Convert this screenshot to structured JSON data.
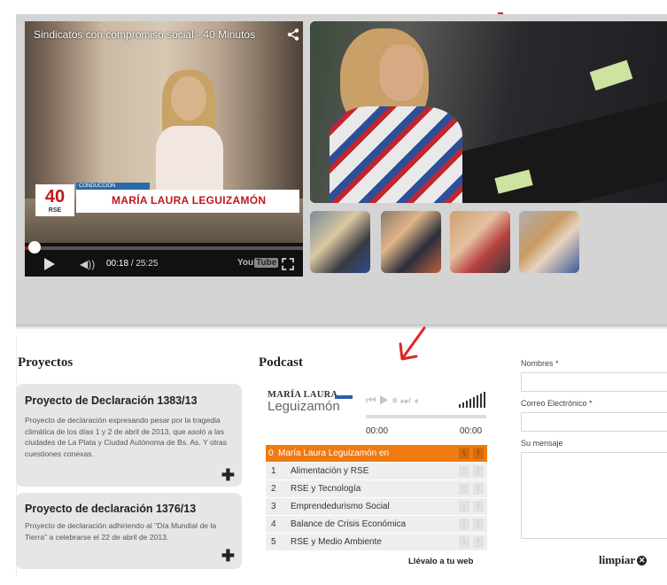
{
  "video": {
    "title": "Sindicatos con compromiso social - 40 Minutos",
    "lower_third_logo": "40",
    "lower_third_logo_sub": "RSE",
    "lower_third_caption": "CONDUCCIÓN",
    "lower_third_name": "MARÍA LAURA LEGUIZAMÓN",
    "time_current": "00:18",
    "time_total": "/ 25:25",
    "youtube_label": "You",
    "youtube_label_box": "Tube",
    "progress": 0.012
  },
  "proyectos": {
    "heading": "Proyectos",
    "items": [
      {
        "title": "Proyecto de Declaración 1383/13",
        "text": "Proyecto de declaración expresando pesar por la tragedia climática de los días 1 y 2 de abril de 2013, que asoló a las ciudades de La Plata y Ciudad Autónoma de Bs. As. Y otras cuestiones conexas."
      },
      {
        "title": "Proyecto de declaración 1376/13",
        "text": "Proyecto de declaración adhiriendo al \"Día Mundial de la Tierra\" a celebrarse el 22 de abril de 2013."
      }
    ]
  },
  "podcast": {
    "heading": "Podcast",
    "logo_line1": "MARÍA LAURA",
    "logo_line2": "Leguizamón",
    "time_start": "00:00",
    "time_end": "00:00",
    "playlist": [
      {
        "num": "0",
        "title": "María Laura Leguizamón en"
      },
      {
        "num": "1",
        "title": "Alimentación y RSE"
      },
      {
        "num": "2",
        "title": "RSE y Tecnología"
      },
      {
        "num": "3",
        "title": "Emprendedurismo Social"
      },
      {
        "num": "4",
        "title": "Balance de Crisis Económica"
      },
      {
        "num": "5",
        "title": "RSE y Medio Ambiente"
      }
    ],
    "twitter_glyph": "t",
    "facebook_glyph": "f",
    "embed_link": "Llévalo a tu web"
  },
  "form": {
    "name_label": "Nombres *",
    "email_label": "Correo Electrónico *",
    "message_label": "Su mensaje",
    "clear_label": "limpiar"
  },
  "colors": {
    "accent_orange": "#f07a12",
    "panel_gray": "#d4d4d4",
    "card_gray": "#e6e6e6",
    "arrow_red": "#e0242a"
  }
}
